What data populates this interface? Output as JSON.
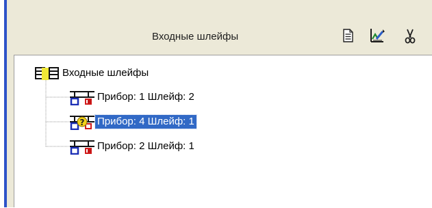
{
  "panel": {
    "title": "Входные шлейфы"
  },
  "toolbar": {
    "buttons": [
      {
        "name": "document-icon"
      },
      {
        "name": "edit-chart-icon"
      },
      {
        "name": "cut-icon"
      }
    ]
  },
  "tree": {
    "root": {
      "label": "Входные шлейфы"
    },
    "children": [
      {
        "label": "Прибор: 1 Шлейф: 2",
        "selected": false,
        "state": "normal"
      },
      {
        "label": "Прибор: 4 Шлейф: 1",
        "selected": true,
        "state": "unknown"
      },
      {
        "label": "Прибор: 2 Шлейф: 1",
        "selected": false,
        "state": "normal"
      }
    ]
  },
  "colors": {
    "accent": "#2d53c8",
    "selection": "#3169c6",
    "panel": "#ece9d8"
  }
}
